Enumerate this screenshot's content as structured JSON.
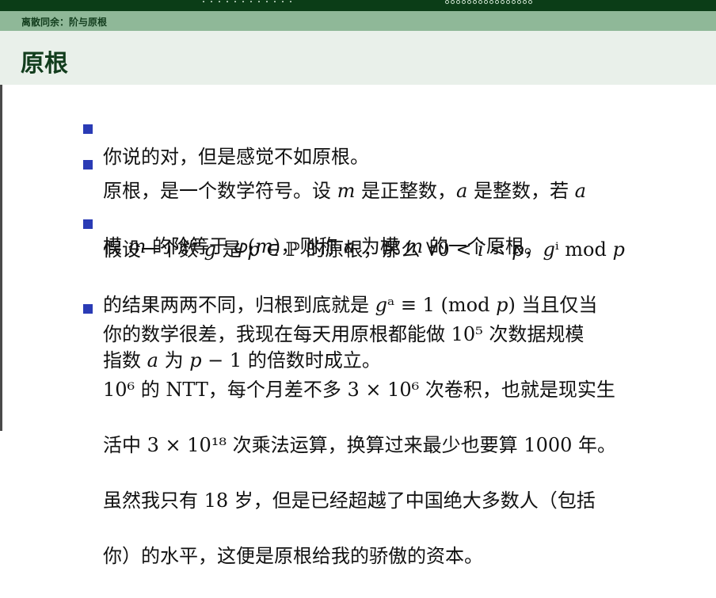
{
  "header": {
    "section_title": "离散同余：阶与原根"
  },
  "frame": {
    "title": "原根"
  },
  "items": [
    {
      "lines": [
        "你说的对，但是感觉不如原根。"
      ]
    },
    {
      "lines": [
        "原根，是一个数学符号。设 𝑚 是正整数，𝑎 是整数，若 𝑎",
        "模 𝑚 的阶等于 𝜑(𝑚)，则称 𝑎 为模 𝑚 的一个原根。"
      ]
    },
    {
      "lines": [
        "假设一个数 𝑔 是 𝑝 ∈ ℙ 的原根，那么 ∀0 < 𝑖 < 𝑝，𝑔ⁱ mod 𝑝",
        "的结果两两不同，归根到底就是 𝑔ᵃ ≡ 1 (mod 𝑝) 当且仅当",
        "指数 𝑎 为 𝑝 − 1 的倍数时成立。"
      ]
    },
    {
      "lines": [
        "你的数学很差，我现在每天用原根都能做 10⁵ 次数据规模",
        "10⁶ 的 NTT，每个月差不多 3 × 10⁶ 次卷积，也就是现实生",
        "活中 3 × 10¹⁸ 次乘法运算，换算过来最少也要算 1000 年。",
        "虽然我只有 18 岁，但是已经超越了中国绝大多数人（包括",
        "你）的水平，这便是原根给我的骄傲的资本。"
      ]
    }
  ]
}
